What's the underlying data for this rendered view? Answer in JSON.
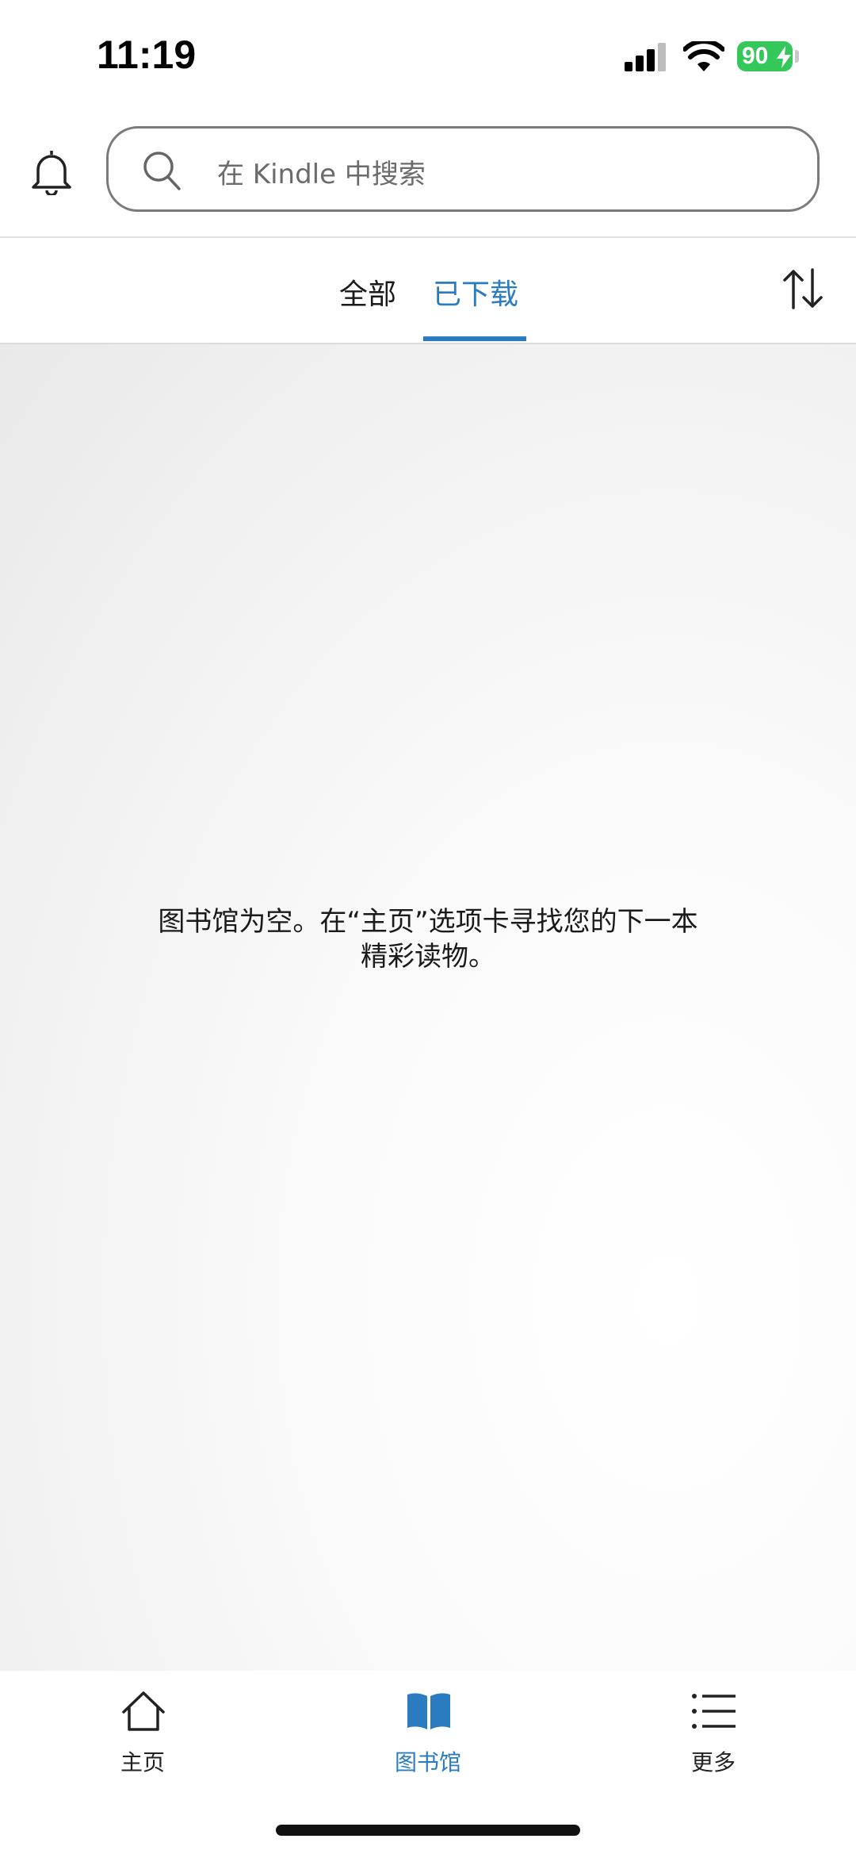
{
  "status_bar": {
    "time": "11:19",
    "battery": "90"
  },
  "header": {
    "bell_icon": "bell-icon",
    "search": {
      "placeholder": "在 Kindle 中搜索",
      "icon": "search-icon"
    }
  },
  "tabs": {
    "items": [
      {
        "label": "全部"
      },
      {
        "label": "已下载"
      }
    ],
    "active_color": "#2a7bbf",
    "sort_icon": "sort-arrows-icon"
  },
  "main": {
    "empty_line1": "图书馆为空。在“主页”选项卡寻找您的下一本",
    "empty_line2": "精彩读物。"
  },
  "bottom_nav": {
    "items": [
      {
        "label": "主页",
        "icon": "home-icon"
      },
      {
        "label": "图书馆",
        "icon": "book-icon"
      },
      {
        "label": "更多",
        "icon": "menu-list-icon"
      }
    ]
  }
}
